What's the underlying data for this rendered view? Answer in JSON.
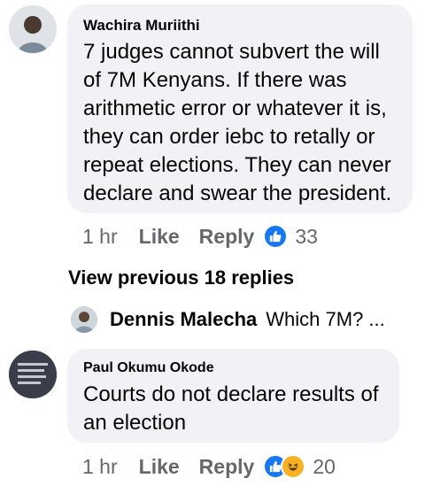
{
  "comment1": {
    "author": "Wachira Muriithi",
    "text_lines": [
      "7 judges cannot subvert the will",
      "of 7M Kenyans. If there was",
      "arithmetic error or whatever it is,",
      "they can order iebc to retally or",
      "repeat elections. They can never",
      "declare and swear the president."
    ],
    "time": "1 hr",
    "like_label": "Like",
    "reply_label": "Reply",
    "reaction_count": "33",
    "reaction_icon": "like-icon"
  },
  "view_previous": "View previous 18 replies",
  "collapsed_reply": {
    "author": "Dennis Malecha",
    "snippet": "Which 7M? ..."
  },
  "comment2": {
    "author": "Paul Okumu Okode",
    "text_lines": [
      "Courts do not declare results of",
      "an election"
    ],
    "time": "1 hr",
    "like_label": "Like",
    "reply_label": "Reply",
    "reaction_count": "20",
    "reaction_icons": [
      "like-icon",
      "haha-icon"
    ]
  },
  "colors": {
    "bubble": "#f0f2f5",
    "meta_text": "#65676b",
    "like_blue": "#1877f2",
    "haha_yellow": "#f7b125"
  }
}
